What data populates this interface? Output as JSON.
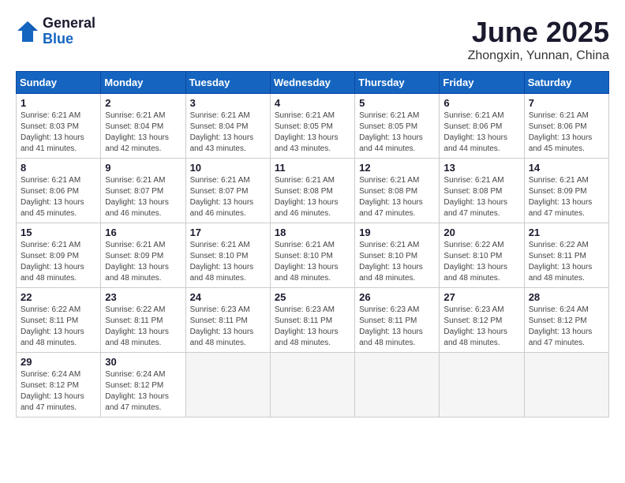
{
  "header": {
    "logo_general": "General",
    "logo_blue": "Blue",
    "month_title": "June 2025",
    "location": "Zhongxin, Yunnan, China"
  },
  "weekdays": [
    "Sunday",
    "Monday",
    "Tuesday",
    "Wednesday",
    "Thursday",
    "Friday",
    "Saturday"
  ],
  "weeks": [
    [
      {
        "day": "1",
        "sunrise": "6:21 AM",
        "sunset": "8:03 PM",
        "daylight": "13 hours and 41 minutes."
      },
      {
        "day": "2",
        "sunrise": "6:21 AM",
        "sunset": "8:04 PM",
        "daylight": "13 hours and 42 minutes."
      },
      {
        "day": "3",
        "sunrise": "6:21 AM",
        "sunset": "8:04 PM",
        "daylight": "13 hours and 43 minutes."
      },
      {
        "day": "4",
        "sunrise": "6:21 AM",
        "sunset": "8:05 PM",
        "daylight": "13 hours and 43 minutes."
      },
      {
        "day": "5",
        "sunrise": "6:21 AM",
        "sunset": "8:05 PM",
        "daylight": "13 hours and 44 minutes."
      },
      {
        "day": "6",
        "sunrise": "6:21 AM",
        "sunset": "8:06 PM",
        "daylight": "13 hours and 44 minutes."
      },
      {
        "day": "7",
        "sunrise": "6:21 AM",
        "sunset": "8:06 PM",
        "daylight": "13 hours and 45 minutes."
      }
    ],
    [
      {
        "day": "8",
        "sunrise": "6:21 AM",
        "sunset": "8:06 PM",
        "daylight": "13 hours and 45 minutes."
      },
      {
        "day": "9",
        "sunrise": "6:21 AM",
        "sunset": "8:07 PM",
        "daylight": "13 hours and 46 minutes."
      },
      {
        "day": "10",
        "sunrise": "6:21 AM",
        "sunset": "8:07 PM",
        "daylight": "13 hours and 46 minutes."
      },
      {
        "day": "11",
        "sunrise": "6:21 AM",
        "sunset": "8:08 PM",
        "daylight": "13 hours and 46 minutes."
      },
      {
        "day": "12",
        "sunrise": "6:21 AM",
        "sunset": "8:08 PM",
        "daylight": "13 hours and 47 minutes."
      },
      {
        "day": "13",
        "sunrise": "6:21 AM",
        "sunset": "8:08 PM",
        "daylight": "13 hours and 47 minutes."
      },
      {
        "day": "14",
        "sunrise": "6:21 AM",
        "sunset": "8:09 PM",
        "daylight": "13 hours and 47 minutes."
      }
    ],
    [
      {
        "day": "15",
        "sunrise": "6:21 AM",
        "sunset": "8:09 PM",
        "daylight": "13 hours and 48 minutes."
      },
      {
        "day": "16",
        "sunrise": "6:21 AM",
        "sunset": "8:09 PM",
        "daylight": "13 hours and 48 minutes."
      },
      {
        "day": "17",
        "sunrise": "6:21 AM",
        "sunset": "8:10 PM",
        "daylight": "13 hours and 48 minutes."
      },
      {
        "day": "18",
        "sunrise": "6:21 AM",
        "sunset": "8:10 PM",
        "daylight": "13 hours and 48 minutes."
      },
      {
        "day": "19",
        "sunrise": "6:21 AM",
        "sunset": "8:10 PM",
        "daylight": "13 hours and 48 minutes."
      },
      {
        "day": "20",
        "sunrise": "6:22 AM",
        "sunset": "8:10 PM",
        "daylight": "13 hours and 48 minutes."
      },
      {
        "day": "21",
        "sunrise": "6:22 AM",
        "sunset": "8:11 PM",
        "daylight": "13 hours and 48 minutes."
      }
    ],
    [
      {
        "day": "22",
        "sunrise": "6:22 AM",
        "sunset": "8:11 PM",
        "daylight": "13 hours and 48 minutes."
      },
      {
        "day": "23",
        "sunrise": "6:22 AM",
        "sunset": "8:11 PM",
        "daylight": "13 hours and 48 minutes."
      },
      {
        "day": "24",
        "sunrise": "6:23 AM",
        "sunset": "8:11 PM",
        "daylight": "13 hours and 48 minutes."
      },
      {
        "day": "25",
        "sunrise": "6:23 AM",
        "sunset": "8:11 PM",
        "daylight": "13 hours and 48 minutes."
      },
      {
        "day": "26",
        "sunrise": "6:23 AM",
        "sunset": "8:11 PM",
        "daylight": "13 hours and 48 minutes."
      },
      {
        "day": "27",
        "sunrise": "6:23 AM",
        "sunset": "8:12 PM",
        "daylight": "13 hours and 48 minutes."
      },
      {
        "day": "28",
        "sunrise": "6:24 AM",
        "sunset": "8:12 PM",
        "daylight": "13 hours and 47 minutes."
      }
    ],
    [
      {
        "day": "29",
        "sunrise": "6:24 AM",
        "sunset": "8:12 PM",
        "daylight": "13 hours and 47 minutes."
      },
      {
        "day": "30",
        "sunrise": "6:24 AM",
        "sunset": "8:12 PM",
        "daylight": "13 hours and 47 minutes."
      },
      null,
      null,
      null,
      null,
      null
    ]
  ],
  "labels": {
    "sunrise": "Sunrise:",
    "sunset": "Sunset:",
    "daylight": "Daylight:"
  }
}
